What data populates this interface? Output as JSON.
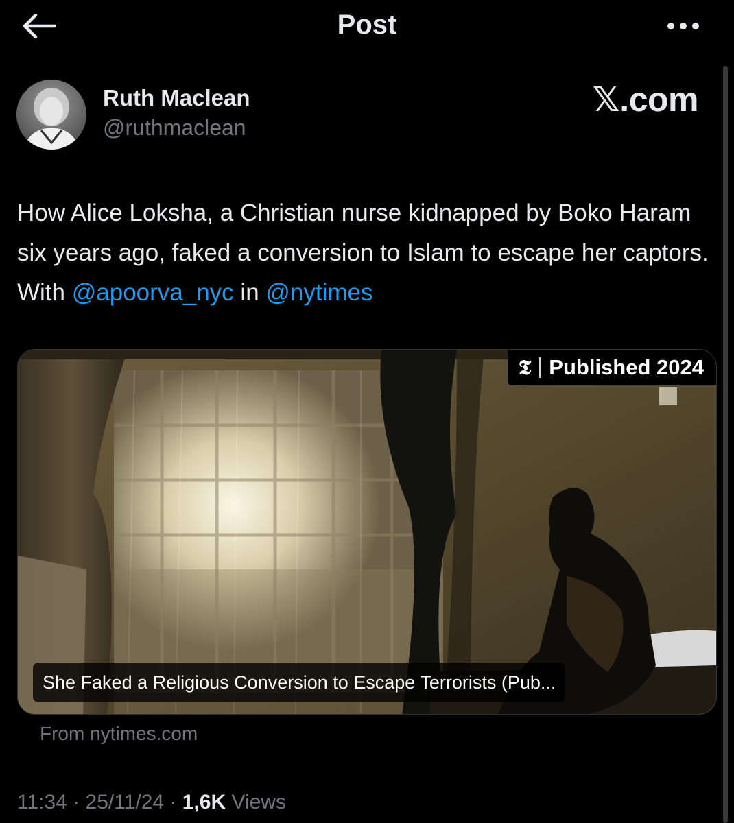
{
  "header": {
    "title": "Post",
    "back_icon": "arrow-left-icon",
    "more_icon": "more-horizontal-icon"
  },
  "author": {
    "name": "Ruth Maclean",
    "handle": "@ruthmaclean"
  },
  "brand": "𝕏.com",
  "tweet": {
    "text_before": "How Alice Loksha, a Christian nurse kidnapped by Boko Haram six years ago, faked a conversion to Islam to escape her captors. With ",
    "mention_1": "@apoorva_nyc",
    "text_between": " in ",
    "mention_2": "@nytimes"
  },
  "link_card": {
    "badge_logo": "𝕿",
    "badge_text": "Published 2024",
    "caption": "She Faked a Religious Conversion to Escape Terrorists (Pub...",
    "source": "From nytimes.com"
  },
  "meta": {
    "time": "11:34",
    "date": "25/11/24",
    "views_count": "1,6K",
    "views_label": "Views"
  },
  "colors": {
    "background": "#000000",
    "text": "#e7e9ea",
    "secondary": "#71767b",
    "link": "#1d9bf0"
  }
}
